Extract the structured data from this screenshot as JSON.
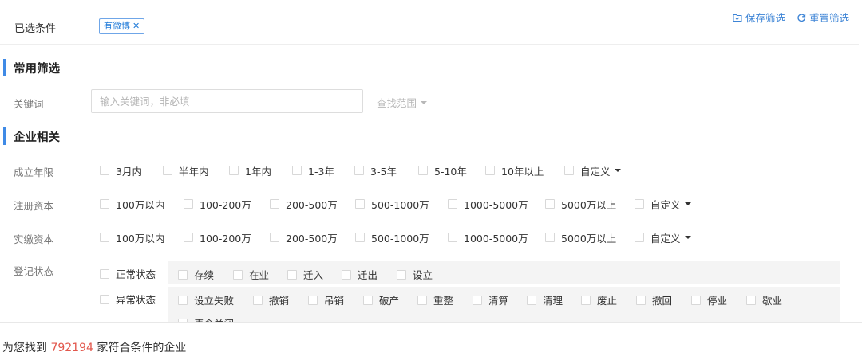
{
  "selected": {
    "label": "已选条件",
    "tags": [
      {
        "label": "有微博"
      }
    ],
    "actions": [
      {
        "label": "保存筛选",
        "icon": "folder-save-icon"
      },
      {
        "label": "重置筛选",
        "icon": "refresh-icon"
      }
    ]
  },
  "common": {
    "title": "常用筛选",
    "keyword_label": "关键词",
    "keyword_placeholder": "输入关键词，非必填",
    "keyword_value": "",
    "scope_label": "查找范围"
  },
  "company": {
    "title": "企业相关",
    "founded": {
      "label": "成立年限",
      "options": [
        "3月内",
        "半年内",
        "1年内",
        "1-3年",
        "3-5年",
        "5-10年",
        "10年以上",
        "自定义"
      ]
    },
    "registered_capital": {
      "label": "注册资本",
      "options": [
        "100万以内",
        "100-200万",
        "200-500万",
        "500-1000万",
        "1000-5000万",
        "5000万以上",
        "自定义"
      ]
    },
    "paid_capital": {
      "label": "实缴资本",
      "options": [
        "100万以内",
        "100-200万",
        "200-500万",
        "500-1000万",
        "1000-5000万",
        "5000万以上",
        "自定义"
      ]
    },
    "status": {
      "label": "登记状态",
      "normal": {
        "label": "正常状态",
        "options": [
          "存续",
          "在业",
          "迁入",
          "迁出",
          "设立"
        ]
      },
      "abnormal": {
        "label": "异常状态",
        "options": [
          "设立失败",
          "撤销",
          "吊销",
          "破产",
          "重整",
          "清算",
          "清理",
          "废止",
          "撤回",
          "停业",
          "歇业",
          "责令关闭"
        ]
      }
    }
  },
  "result": {
    "prefix": "为您找到",
    "count": "792194",
    "suffix": "家符合条件的企业"
  },
  "colors": {
    "accent": "#3f8ae6",
    "link": "#3d84d6",
    "count": "#e2574c"
  }
}
